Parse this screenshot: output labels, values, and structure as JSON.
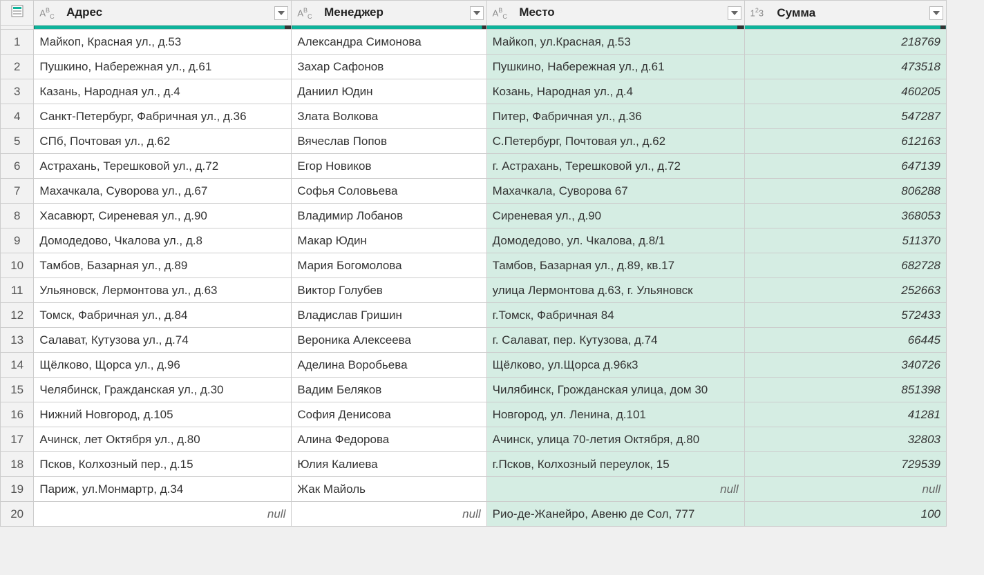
{
  "columns": [
    {
      "key": "address",
      "label": "Адрес",
      "type_label": "text"
    },
    {
      "key": "manager",
      "label": "Менеджер",
      "type_label": "text"
    },
    {
      "key": "place",
      "label": "Место",
      "type_label": "text"
    },
    {
      "key": "sum",
      "label": "Сумма",
      "type_label": "number"
    }
  ],
  "type_icons": {
    "text": "AᴮC",
    "number": "1²3"
  },
  "null_text": "null",
  "rows": [
    {
      "n": 1,
      "address": "Майкоп, Красная ул., д.53",
      "manager": "Александра Симонова",
      "place": "Майкоп, ул.Красная, д.53",
      "sum": 218769
    },
    {
      "n": 2,
      "address": "Пушкино, Набережная ул., д.61",
      "manager": "Захар Сафонов",
      "place": "Пушкино, Набережная ул., д.61",
      "sum": 473518
    },
    {
      "n": 3,
      "address": "Казань, Народная ул., д.4",
      "manager": "Даниил Юдин",
      "place": "Козань, Народная ул., д.4",
      "sum": 460205
    },
    {
      "n": 4,
      "address": "Санкт-Петербург, Фабричная ул., д.36",
      "manager": "Злата Волкова",
      "place": "Питер, Фабричная ул., д.36",
      "sum": 547287
    },
    {
      "n": 5,
      "address": "СПб, Почтовая ул., д.62",
      "manager": "Вячеслав Попов",
      "place": "С.Петербург, Почтовая ул., д.62",
      "sum": 612163
    },
    {
      "n": 6,
      "address": "Астрахань, Терешковой ул., д.72",
      "manager": "Егор Новиков",
      "place": "г. Астрахань, Терешковой ул., д.72",
      "sum": 647139
    },
    {
      "n": 7,
      "address": "Махачкала, Суворова ул., д.67",
      "manager": "Софья Соловьева",
      "place": "Махачкала, Суворова 67",
      "sum": 806288
    },
    {
      "n": 8,
      "address": "Хасавюрт, Сиреневая ул., д.90",
      "manager": "Владимир Лобанов",
      "place": "Сиреневая ул., д.90",
      "sum": 368053
    },
    {
      "n": 9,
      "address": "Домодедово, Чкалова ул., д.8",
      "manager": "Макар Юдин",
      "place": "Домодедово, ул. Чкалова, д.8/1",
      "sum": 511370
    },
    {
      "n": 10,
      "address": "Тамбов, Базарная ул., д.89",
      "manager": "Мария Богомолова",
      "place": "Тамбов, Базарная ул., д.89, кв.17",
      "sum": 682728
    },
    {
      "n": 11,
      "address": "Ульяновск, Лермонтова ул., д.63",
      "manager": "Виктор Голубев",
      "place": "улица Лермонтова д.63, г. Ульяновск",
      "sum": 252663
    },
    {
      "n": 12,
      "address": "Томск, Фабричная ул., д.84",
      "manager": "Владислав Гришин",
      "place": "г.Томск, Фабричная 84",
      "sum": 572433
    },
    {
      "n": 13,
      "address": "Салават, Кутузова ул., д.74",
      "manager": "Вероника Алексеева",
      "place": "г. Салават, пер. Кутузова, д.74",
      "sum": 66445
    },
    {
      "n": 14,
      "address": "Щёлково, Щорса ул., д.96",
      "manager": "Аделина Воробьева",
      "place": "Щёлково, ул.Щорса д.96к3",
      "sum": 340726
    },
    {
      "n": 15,
      "address": "Челябинск, Гражданская ул., д.30",
      "manager": "Вадим Беляков",
      "place": "Чилябинск, Грожданская улица, дом 30",
      "sum": 851398
    },
    {
      "n": 16,
      "address": "Нижний Новгород, д.105",
      "manager": "София Денисова",
      "place": "Новгород, ул. Ленина, д.101",
      "sum": 41281
    },
    {
      "n": 17,
      "address": "Ачинск, лет Октября ул., д.80",
      "manager": "Алина Федорова",
      "place": "Ачинск, улица 70-летия Октября, д.80",
      "sum": 32803
    },
    {
      "n": 18,
      "address": "Псков, Колхозный пер., д.15",
      "manager": "Юлия Калиева",
      "place": "г.Псков, Колхозный переулок, 15",
      "sum": 729539
    },
    {
      "n": 19,
      "address": "Париж, ул.Монмартр, д.34",
      "manager": "Жак Майоль",
      "place": null,
      "sum": null
    },
    {
      "n": 20,
      "address": null,
      "manager": null,
      "place": "Рио-де-Жанейро, Авеню де Сол, 777",
      "sum": 100
    }
  ]
}
